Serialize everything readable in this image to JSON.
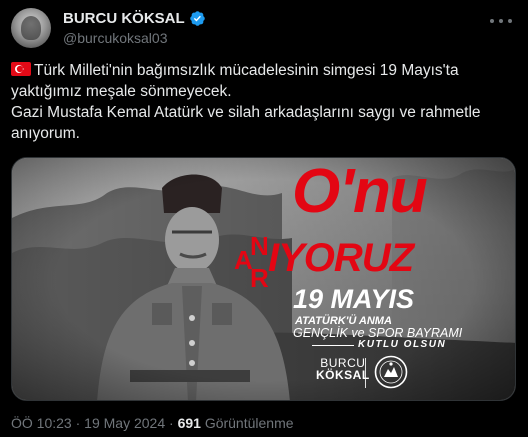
{
  "author": {
    "display_name": "BURCU KÖKSAL",
    "handle": "@burcukoksal03",
    "verified": true,
    "verified_color": "#1d9bf0"
  },
  "tweet": {
    "flag_icon": "turkey-flag-icon",
    "line1": "Türk Milleti'nin bağımsızlık mücadelesinin simgesi 19 Mayıs'ta yaktığımız meşale sönmeyecek.",
    "line2": "Gazi Mustafa Kemal Atatürk ve silah arkadaşlarını saygı ve rahmetle anıyorum."
  },
  "media": {
    "headline": "O'nu",
    "anir_letters": [
      "A",
      "N",
      "R"
    ],
    "iyoruz": "IYORUZ",
    "date": "19 MAYIS",
    "anma": "ATATÜRK'Ü ANMA",
    "genclik": "GENÇLİK ve SPOR BAYRAMI",
    "kutlu": "KUTLU OLSUN",
    "brand_line1": "BURCU",
    "brand_line2": "KÖKSAL",
    "accent_color": "#e30613"
  },
  "meta": {
    "time": "ÖÖ 10:23",
    "separator": "·",
    "date": "19 May 2024",
    "views_count": "691",
    "views_label": "Görüntülenme"
  }
}
